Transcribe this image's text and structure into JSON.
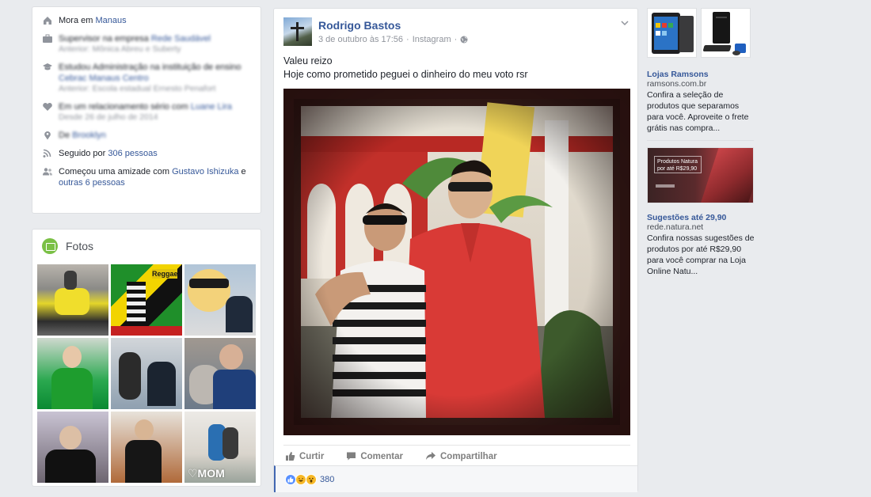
{
  "about": {
    "items": [
      {
        "icon": "home-icon",
        "prefix": "Mora em ",
        "link": "Manaus",
        "sub": "",
        "blurred": false
      },
      {
        "icon": "briefcase-icon",
        "prefix": "Supervisor na empresa ",
        "link": "Rede Saudável",
        "sub": "Anterior: Mônica Abreu e Suberty",
        "blurred": true
      },
      {
        "icon": "graduation-cap-icon",
        "prefix": "Estudou Administração na instituição de ensino ",
        "link": "Cebrac Manaus Centro",
        "sub": "Anterior: Escola estadual Ernesto Penafort",
        "blurred": true
      },
      {
        "icon": "heart-icon",
        "prefix": "Em um relacionamento sério com ",
        "link": "Luane Lira",
        "sub": "Desde 26 de julho de 2014",
        "blurred": true
      },
      {
        "icon": "location-pin-icon",
        "prefix": "De ",
        "link": "Brooklyn",
        "sub": "",
        "blurred": true
      },
      {
        "icon": "rss-icon",
        "prefix": "Seguido por ",
        "link": "306 pessoas",
        "sub": "",
        "blurred": false
      },
      {
        "icon": "friends-icon",
        "prefix": "Começou uma amizade com ",
        "link": "Gustavo Ishizuka",
        "mid": " e ",
        "link2": "outras 6 pessoas",
        "sub": "",
        "blurred": false
      }
    ]
  },
  "photos": {
    "title": "Fotos",
    "thumbs": [
      {
        "label": ""
      },
      {
        "label": ""
      },
      {
        "label": ""
      },
      {
        "label": ""
      },
      {
        "label": ""
      },
      {
        "label": ""
      },
      {
        "label": ""
      },
      {
        "label": ""
      },
      {
        "label": "♡MOM"
      }
    ]
  },
  "post": {
    "author": "Rodrigo Bastos",
    "date": "3 de outubro às 17:56",
    "source": "Instagram",
    "text_line1": "Valeu reizo",
    "text_line2": "Hoje como prometido peguei o dinheiro do meu voto rsr",
    "actions": {
      "like": "Curtir",
      "comment": "Comentar",
      "share": "Compartilhar"
    },
    "reactions": {
      "count": "380"
    },
    "colors": {
      "link": "#365899",
      "like_blue": "#5890ff",
      "haha_yellow": "#f7b928"
    }
  },
  "ads": [
    {
      "title": "Lojas Ramsons",
      "domain": "ramsons.com.br",
      "desc": "Confira a seleção de produtos que separamos para você. Aproveite o frete grátis nas compra..."
    },
    {
      "title": "Sugestões até 29,90",
      "domain": "rede.natura.net",
      "desc": "Confira nossas sugestões de produtos por até R$29,90 para você comprar na Loja Online Natu...",
      "banner_text": "Produtos Natura por até R$29,90"
    }
  ]
}
